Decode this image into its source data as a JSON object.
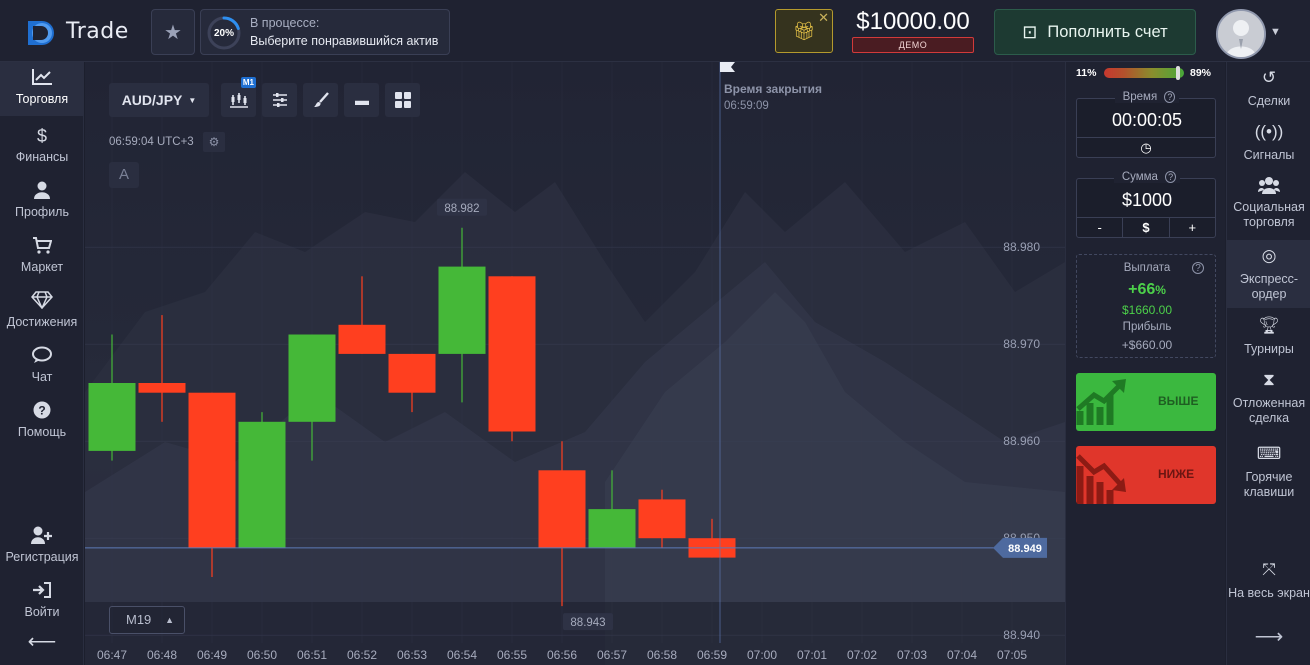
{
  "header": {
    "logo_text": "Trade",
    "progress_percent": "20%",
    "progress_value": 0.2,
    "progress_title": "В процессе:",
    "progress_desc": "Выберите понравившийся актив",
    "balance": "$10000.00",
    "account_type": "ДЕМО",
    "deposit_label": "Пополнить счет"
  },
  "left_nav": [
    {
      "label": "Торговля",
      "icon": "chart-line-icon"
    },
    {
      "label": "Финансы",
      "icon": "dollar-icon"
    },
    {
      "label": "Профиль",
      "icon": "user-icon"
    },
    {
      "label": "Маркет",
      "icon": "cart-icon"
    },
    {
      "label": "Достижения",
      "icon": "diamond-icon"
    },
    {
      "label": "Чат",
      "icon": "chat-icon"
    },
    {
      "label": "Помощь",
      "icon": "help-icon"
    }
  ],
  "left_nav_bottom": [
    {
      "label": "Регистрация",
      "icon": "user-plus-icon"
    },
    {
      "label": "Войти",
      "icon": "sign-in-icon"
    }
  ],
  "chart_toolbar": {
    "pair": "AUD/JPY",
    "timeframe_badge": "M1",
    "clock": "06:59:04 UTC+3",
    "a_label": "A",
    "zoom_selector": "M19"
  },
  "chart_data": {
    "type": "candlestick",
    "pair": "AUD/JPY",
    "x": [
      "06:47",
      "06:48",
      "06:49",
      "06:50",
      "06:51",
      "06:52",
      "06:53",
      "06:54",
      "06:55",
      "06:56",
      "06:57",
      "06:58",
      "06:59"
    ],
    "candles": [
      {
        "t": "06:47",
        "open": 88.959,
        "close": 88.966,
        "high": 88.971,
        "low": 88.958
      },
      {
        "t": "06:48",
        "open": 88.966,
        "close": 88.965,
        "high": 88.973,
        "low": 88.962
      },
      {
        "t": "06:49",
        "open": 88.965,
        "close": 88.949,
        "high": 88.965,
        "low": 88.946
      },
      {
        "t": "06:50",
        "open": 88.949,
        "close": 88.962,
        "high": 88.963,
        "low": 88.949
      },
      {
        "t": "06:51",
        "open": 88.962,
        "close": 88.971,
        "high": 88.971,
        "low": 88.958
      },
      {
        "t": "06:52",
        "open": 88.972,
        "close": 88.969,
        "high": 88.977,
        "low": 88.969
      },
      {
        "t": "06:53",
        "open": 88.969,
        "close": 88.965,
        "high": 88.969,
        "low": 88.963
      },
      {
        "t": "06:54",
        "open": 88.969,
        "close": 88.978,
        "high": 88.982,
        "low": 88.964
      },
      {
        "t": "06:55",
        "open": 88.977,
        "close": 88.961,
        "high": 88.977,
        "low": 88.96
      },
      {
        "t": "06:56",
        "open": 88.957,
        "close": 88.949,
        "high": 88.96,
        "low": 88.943
      },
      {
        "t": "06:57",
        "open": 88.949,
        "close": 88.953,
        "high": 88.957,
        "low": 88.949
      },
      {
        "t": "06:58",
        "open": 88.954,
        "close": 88.95,
        "high": 88.955,
        "low": 88.949
      },
      {
        "t": "06:59",
        "open": 88.95,
        "close": 88.948,
        "high": 88.952,
        "low": 88.948
      }
    ],
    "future_ticks": [
      "07:00",
      "07:01",
      "07:02",
      "07:03",
      "07:04",
      "07:05"
    ],
    "y_ticks": [
      "88.980",
      "88.970",
      "88.960",
      "88.950",
      "88.940"
    ],
    "ylim": [
      88.9393,
      88.9927
    ],
    "current_price": "88.949",
    "high_label": "88.982",
    "low_label": "88.943",
    "close_time_label": "Время закрытия",
    "close_time": "06:59:09",
    "colors": {
      "up": "#45b838",
      "down": "#ff3f1f",
      "price_line": "#5d7ab8",
      "price_tag": "#4e6a9f"
    }
  },
  "right_panel": {
    "sentiment_low": "11%",
    "sentiment_high": "89%",
    "time_title": "Время",
    "time_value": "00:00:05",
    "amount_title": "Сумма",
    "amount_value": "$1000",
    "amount_minus": "-",
    "amount_currency": "$",
    "amount_plus": "+",
    "payout_title": "Выплата",
    "payout_pct_num": "+66",
    "payout_pct_sign": "%",
    "payout_amount": "$1660.00",
    "profit_label": "Прибыль",
    "profit_value": "+$660.00",
    "up_label": "ВЫШЕ",
    "down_label": "НИЖЕ"
  },
  "right_nav": [
    {
      "label": "Сделки",
      "icon": "history-icon"
    },
    {
      "label": "Сигналы",
      "icon": "signal-icon"
    },
    {
      "label": "Социальная торговля",
      "icon": "users-icon"
    },
    {
      "label": "Экспресс-ордер",
      "icon": "target-icon"
    },
    {
      "label": "Турниры",
      "icon": "trophy-icon"
    },
    {
      "label": "Отложенная сделка",
      "icon": "hourglass-icon"
    },
    {
      "label": "Горячие клавиши",
      "icon": "keyboard-icon"
    },
    {
      "label": "На весь экран",
      "icon": "fullscreen-icon"
    }
  ]
}
